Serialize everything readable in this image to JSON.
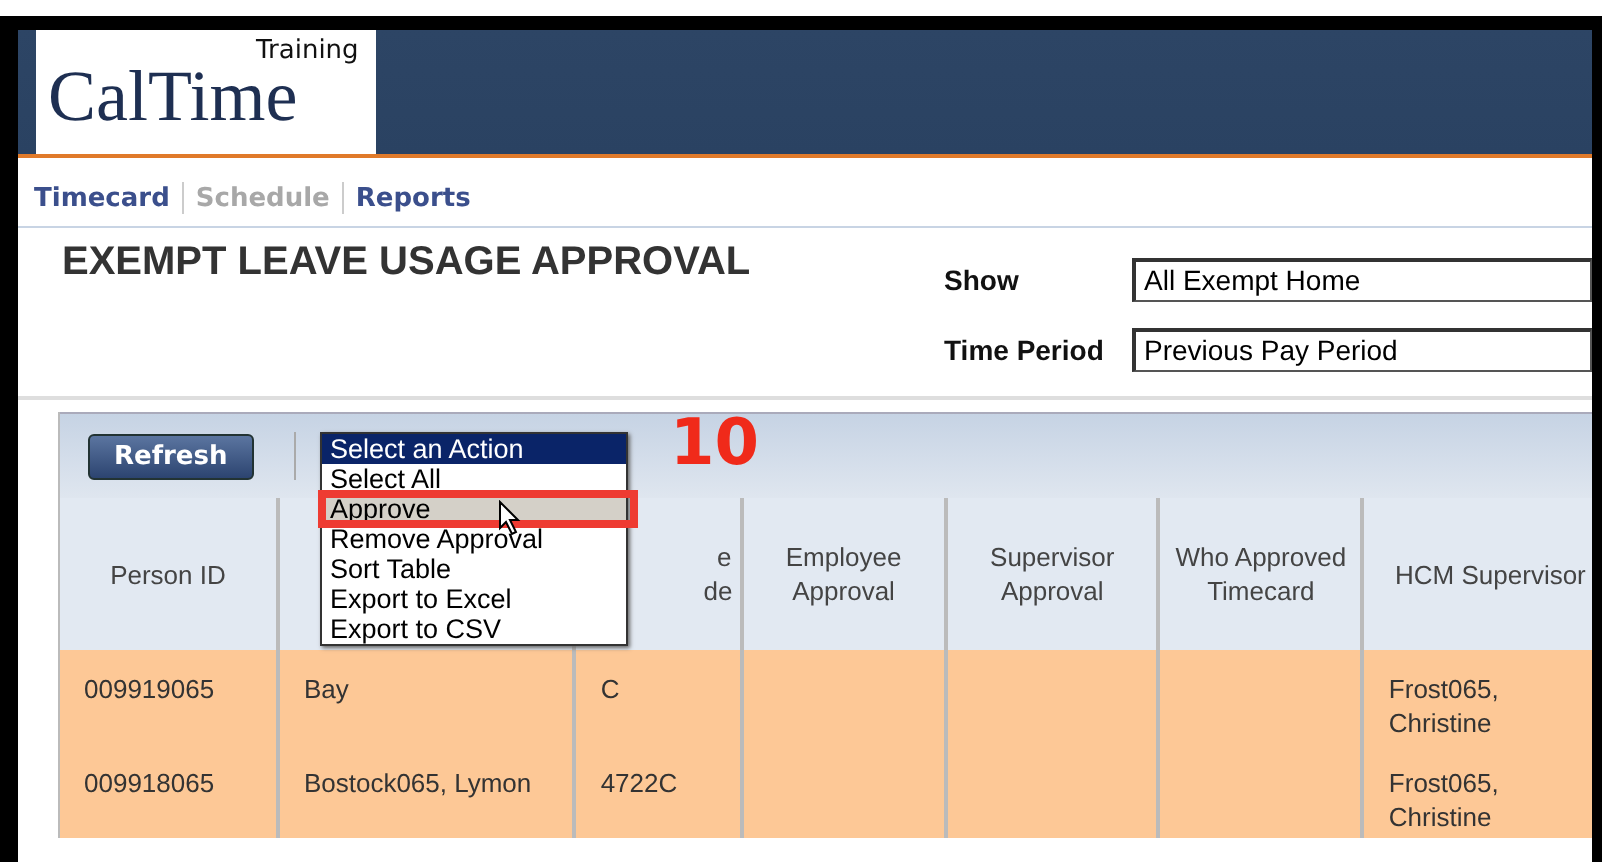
{
  "logo": {
    "brand": "CalTime",
    "tag": "Training"
  },
  "nav": [
    {
      "label": "Timecard",
      "disabled": false
    },
    {
      "label": "Schedule",
      "disabled": true
    },
    {
      "label": "Reports",
      "disabled": false
    }
  ],
  "page_title": "EXEMPT LEAVE USAGE APPROVAL",
  "filters": [
    {
      "label": "Show",
      "value": "All Exempt Home"
    },
    {
      "label": "Time Period",
      "value": "Previous Pay Period"
    }
  ],
  "toolbar": {
    "refresh": "Refresh"
  },
  "action_menu": {
    "items": [
      {
        "label": "Select an Action",
        "selected": true,
        "hovered": false
      },
      {
        "label": "Select All",
        "selected": false,
        "hovered": false
      },
      {
        "label": "Approve",
        "selected": false,
        "hovered": true
      },
      {
        "label": "Remove Approval",
        "selected": false,
        "hovered": false
      },
      {
        "label": "Sort Table",
        "selected": false,
        "hovered": false
      },
      {
        "label": "Export to Excel",
        "selected": false,
        "hovered": false
      },
      {
        "label": "Export to CSV",
        "selected": false,
        "hovered": false
      }
    ]
  },
  "annotation": {
    "step": "10"
  },
  "table": {
    "columns": [
      "Person ID",
      "",
      "e de",
      "Employee Approval",
      "Supervisor Approval",
      "Who Approved Timecard",
      "HCM Supervisor"
    ],
    "rows": [
      [
        "009919065",
        "Bay",
        "C",
        "",
        "",
        "",
        "Frost065, Christine"
      ],
      [
        "009918065",
        "Bostock065, Lymon",
        "4722C",
        "",
        "",
        "",
        "Frost065, Christine"
      ]
    ]
  }
}
